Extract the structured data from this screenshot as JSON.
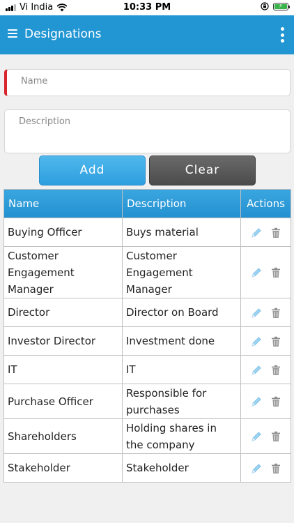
{
  "status_bar": {
    "carrier": "Vi India",
    "time": "10:33 PM"
  },
  "header": {
    "title": "Designations"
  },
  "form": {
    "name_placeholder": "Name",
    "description_placeholder": "Description",
    "add_label": "Add",
    "clear_label": "Clear"
  },
  "table": {
    "headers": {
      "name": "Name",
      "description": "Description",
      "actions": "Actions"
    },
    "rows": [
      {
        "name": "Buying Officer",
        "description": "Buys material"
      },
      {
        "name": "Customer Engagement Manager",
        "description": "Customer Engagement Manager"
      },
      {
        "name": "Director",
        "description": "Director on Board"
      },
      {
        "name": "Investor Director",
        "description": "Investment done"
      },
      {
        "name": "IT",
        "description": "IT"
      },
      {
        "name": "Purchase Officer",
        "description": "Responsible for purchases"
      },
      {
        "name": "Shareholders",
        "description": "Holding shares in the company"
      },
      {
        "name": "Stakeholder",
        "description": "Stakeholder"
      }
    ]
  },
  "colors": {
    "accent": "#2196d3",
    "required": "#d9262c",
    "clear_button": "#555555"
  },
  "icons": {
    "edit": "pencil-icon",
    "delete": "trash-icon"
  }
}
